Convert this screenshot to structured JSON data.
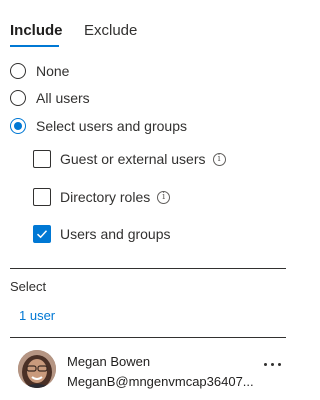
{
  "tabs": {
    "include": "Include",
    "exclude": "Exclude"
  },
  "radios": [
    {
      "label": "None",
      "checked": false
    },
    {
      "label": "All users",
      "checked": false
    },
    {
      "label": "Select users and groups",
      "checked": true
    }
  ],
  "checkboxes": [
    {
      "label": "Guest or external users",
      "checked": false,
      "info": true
    },
    {
      "label": "Directory roles",
      "checked": false,
      "info": true
    },
    {
      "label": "Users and groups",
      "checked": true,
      "info": false
    }
  ],
  "select": {
    "label": "Select",
    "link": "1 user"
  },
  "selected_user": {
    "name": "Megan Bowen",
    "email": "MeganB@mngenvmcap36407..."
  },
  "colors": {
    "accent": "#0078d4",
    "text": "#323130"
  }
}
